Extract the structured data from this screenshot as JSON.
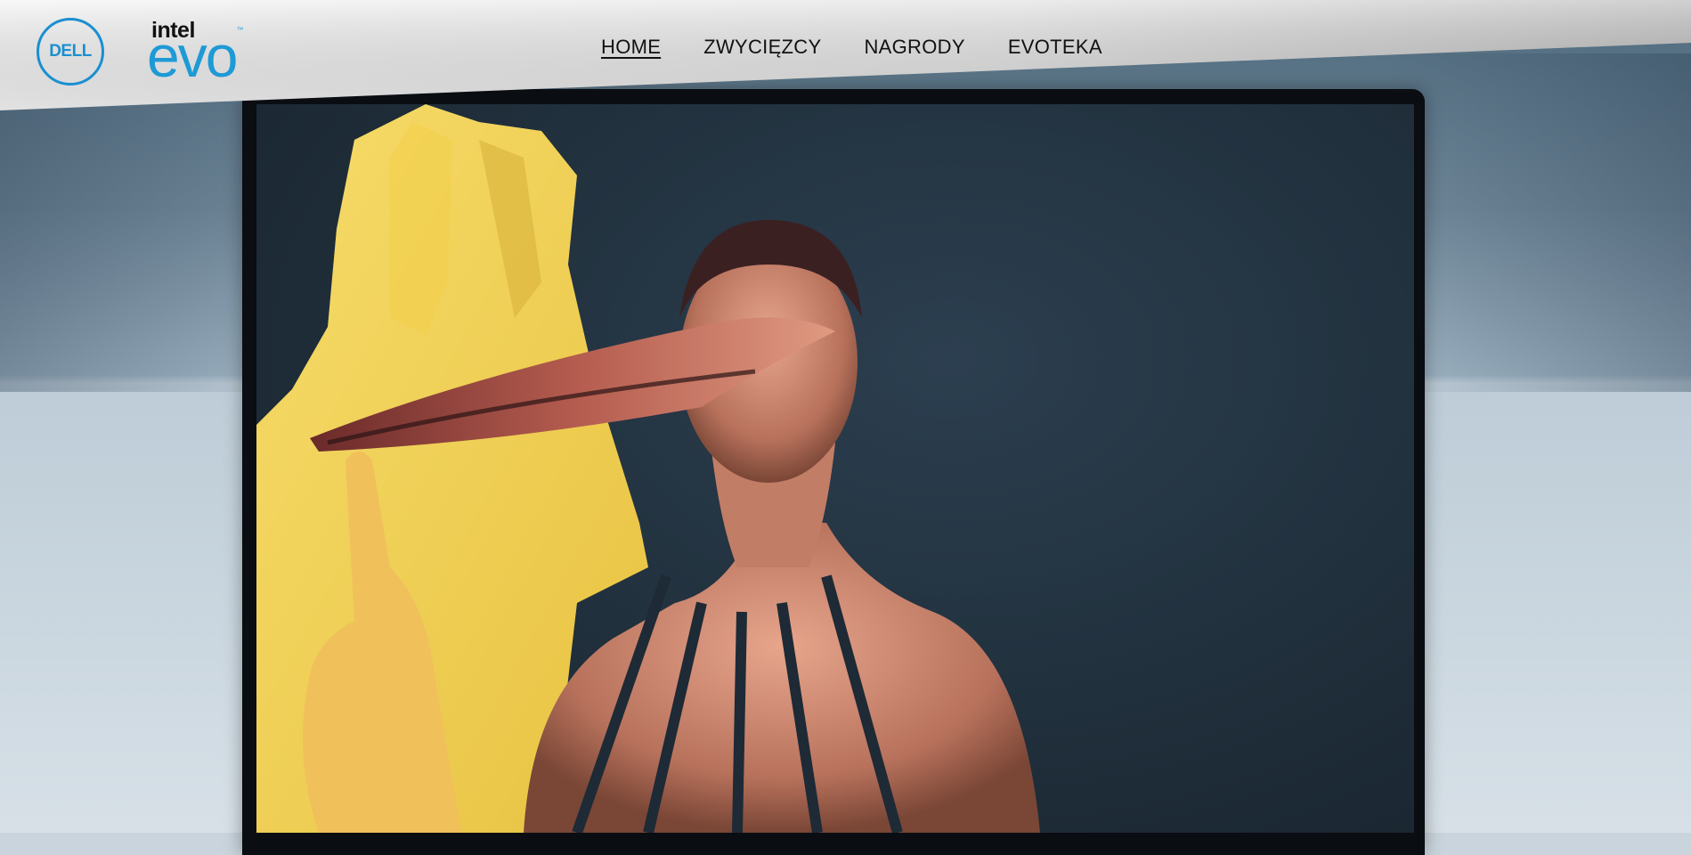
{
  "brand": {
    "dell_logo_text": "DELL",
    "intel_text": "intel",
    "evo_text": "evo",
    "tm": "™",
    "accent_color": "#1e9ad6"
  },
  "nav": {
    "items": [
      {
        "label": "HOME",
        "active": true
      },
      {
        "label": "ZWYCIĘZCY",
        "active": false
      },
      {
        "label": "NAGRODY",
        "active": false
      },
      {
        "label": "EVOTEKA",
        "active": false
      }
    ]
  },
  "hero": {
    "video_alt": "hero-video-laptop-screen"
  }
}
